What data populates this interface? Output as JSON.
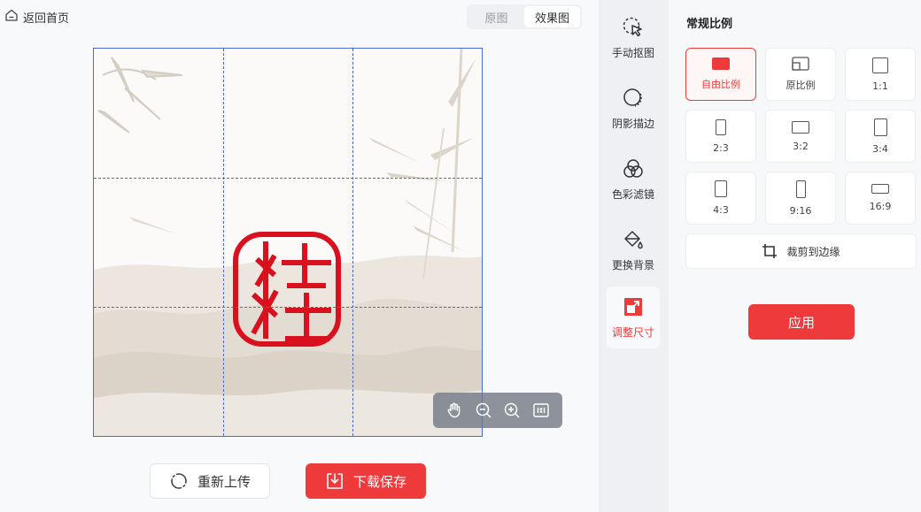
{
  "header": {
    "back_label": "返回首页",
    "view_toggle": {
      "original": "原图",
      "effect": "效果图",
      "active": "effect"
    }
  },
  "actions": {
    "reupload_label": "重新上传",
    "download_label": "下载保存"
  },
  "tool_rail": {
    "items": [
      {
        "label": "手动抠图",
        "icon": "cursor-lasso-icon"
      },
      {
        "label": "阴影描边",
        "icon": "circle-outline-icon"
      },
      {
        "label": "色彩滤镜",
        "icon": "filter-circles-icon"
      },
      {
        "label": "更换背景",
        "icon": "paint-bucket-icon"
      },
      {
        "label": "调整尺寸",
        "icon": "resize-icon",
        "active": true
      }
    ]
  },
  "panel": {
    "title": "常规比例",
    "ratios": [
      {
        "label": "自由比例",
        "active": true
      },
      {
        "label": "原比例"
      },
      {
        "label": "1:1"
      },
      {
        "label": "2:3"
      },
      {
        "label": "3:2"
      },
      {
        "label": "3:4"
      },
      {
        "label": "4:3"
      },
      {
        "label": "9:16"
      },
      {
        "label": "16:9"
      }
    ],
    "crop_edge_label": "裁剪到边缘",
    "apply_label": "应用"
  },
  "colors": {
    "accent": "#ee3a3a",
    "grid": "#4a6bd4",
    "seal": "#d9101e"
  }
}
